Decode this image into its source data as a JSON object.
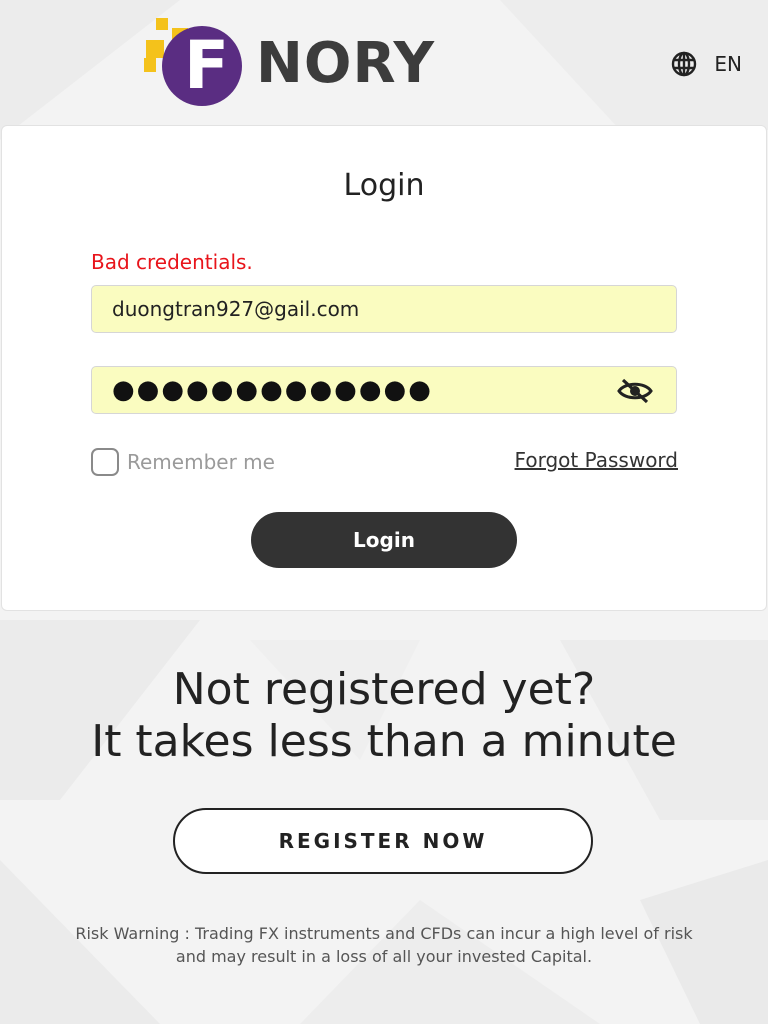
{
  "header": {
    "logo_text": "NORY",
    "logo_letter": "F",
    "language": "EN",
    "language_icon": "globe-icon"
  },
  "login_card": {
    "title": "Login",
    "error_message": "Bad credentials.",
    "email_value": "duongtran927@gail.com",
    "password_mask": "●●●●●●●●●●●●●",
    "password_toggle_icon": "eye-off-icon",
    "remember_label": "Remember me",
    "forgot_label": "Forgot Password",
    "login_button_label": "Login"
  },
  "promo": {
    "line1": "Not registered yet?",
    "line2": "It takes less than a minute",
    "register_button_label": "REGISTER NOW"
  },
  "risk_warning": {
    "line1": "Risk Warning : Trading FX instruments and CFDs can incur a high level of risk",
    "line2": "and may result in a loss of all your invested Capital."
  },
  "colors": {
    "brand_purple": "#5a2d82",
    "brand_yellow": "#f4c21b",
    "error_red": "#e8141b",
    "autofill_yellow": "#fafcc0",
    "button_dark": "#333333"
  }
}
